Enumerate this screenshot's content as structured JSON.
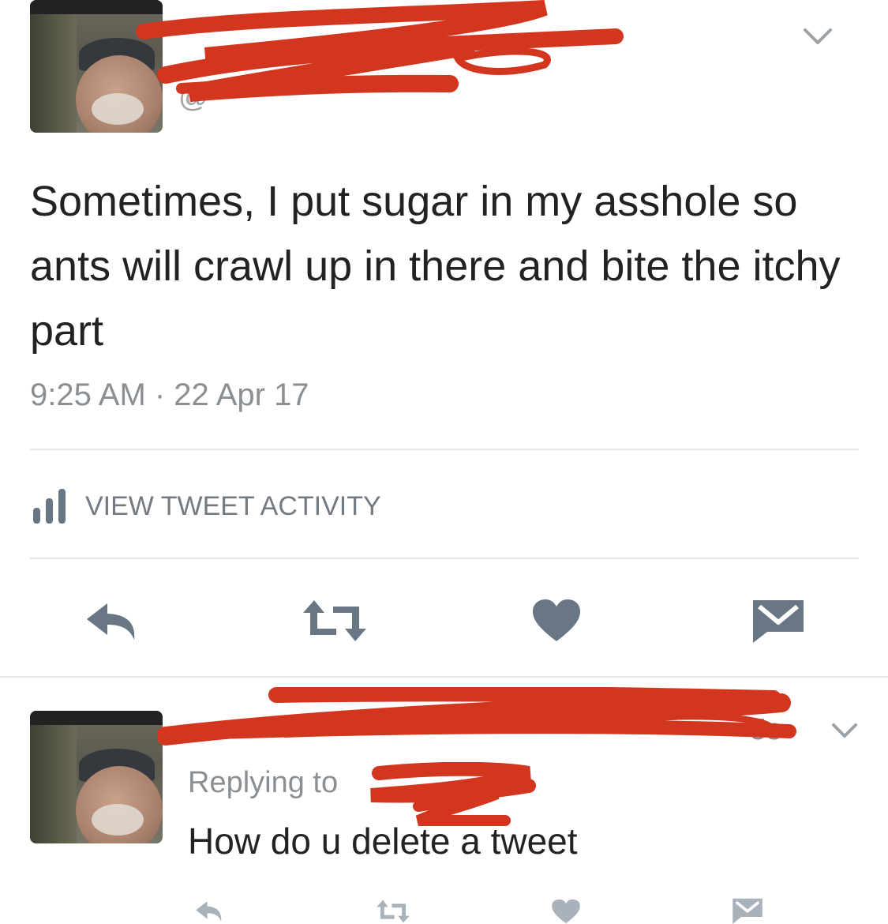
{
  "tweet": {
    "handle_fragment": "@",
    "text": "Sometimes, I put sugar in my asshole so ants will crawl up in there and bite the itchy part",
    "timestamp": "9:25 AM · 22 Apr 17",
    "activity_label": "VIEW TWEET ACTIVITY",
    "actions": [
      "reply-icon",
      "retweet-icon",
      "like-icon",
      "message-icon"
    ]
  },
  "reply": {
    "replying_to_label": "Replying to",
    "text": "How do u delete a tweet",
    "time_fragment": "5s",
    "actions": [
      "reply-icon",
      "retweet-icon",
      "like-icon",
      "message-icon"
    ]
  },
  "colors": {
    "icon": "#697683",
    "icon_light": "#a9b2ba",
    "divider": "#e3e6e8",
    "redaction": "#d3361f",
    "text": "#222222",
    "muted": "#8a8f94"
  }
}
